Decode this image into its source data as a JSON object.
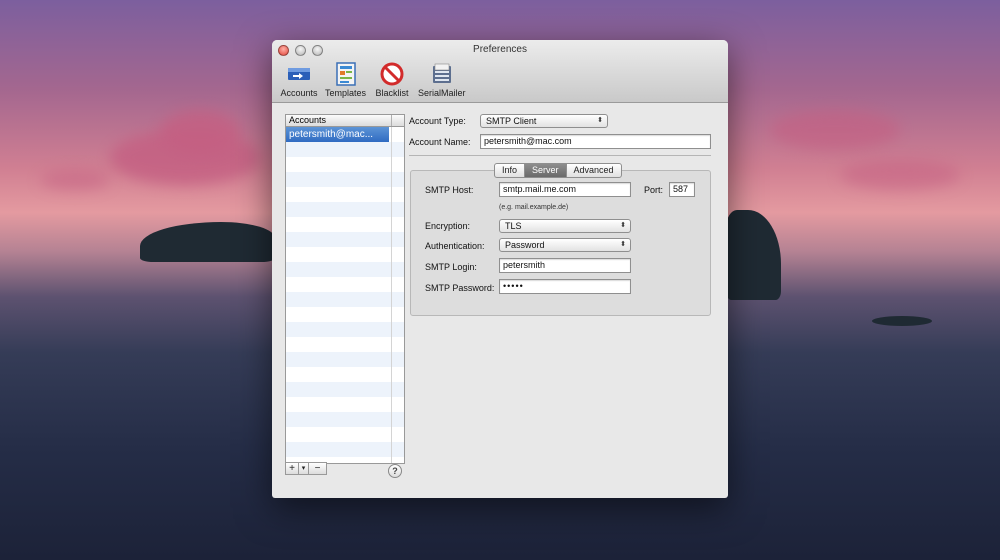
{
  "window": {
    "title": "Preferences"
  },
  "toolbar": {
    "items": [
      {
        "label": "Accounts",
        "icon": "accounts-icon"
      },
      {
        "label": "Templates",
        "icon": "templates-icon"
      },
      {
        "label": "Blacklist",
        "icon": "blacklist-icon"
      },
      {
        "label": "SerialMailer",
        "icon": "serialmailer-icon"
      }
    ]
  },
  "accounts_list": {
    "header": "Accounts",
    "items": [
      "petersmith@mac..."
    ],
    "add_label": "+",
    "add_menu_label": "▾",
    "remove_label": "−",
    "help_label": "?"
  },
  "account": {
    "type_label": "Account Type:",
    "type_value": "SMTP Client",
    "name_label": "Account Name:",
    "name_value": "petersmith@mac.com"
  },
  "tabs": {
    "items": [
      "Info",
      "Server",
      "Advanced"
    ],
    "active": "Server"
  },
  "server": {
    "host_label": "SMTP Host:",
    "host_value": "smtp.mail.me.com",
    "host_hint": "(e.g. mail.example.de)",
    "port_label": "Port:",
    "port_value": "587",
    "encryption_label": "Encryption:",
    "encryption_value": "TLS",
    "auth_label": "Authentication:",
    "auth_value": "Password",
    "login_label": "SMTP Login:",
    "login_value": "petersmith",
    "password_label": "SMTP Password:",
    "password_value": "•••••"
  },
  "colors": {
    "selection": "#3b76c8",
    "window_bg": "#e8e8e8",
    "close_button": "#e2463b"
  }
}
